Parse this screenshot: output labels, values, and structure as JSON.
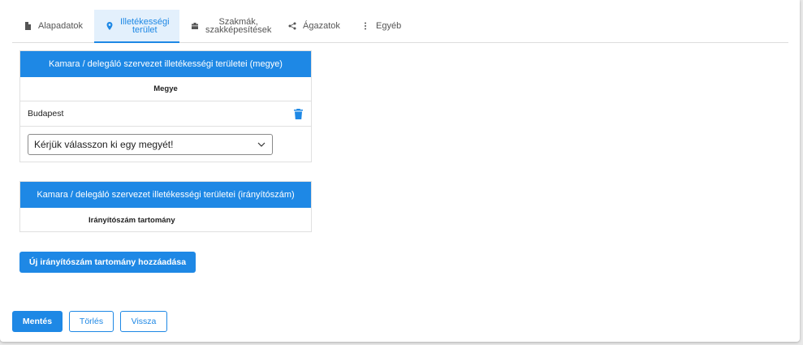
{
  "tabs": [
    {
      "label": "Alapadatok",
      "icon": "document-icon"
    },
    {
      "label": "Illetékességi terület",
      "icon": "location-pin-icon",
      "active": true
    },
    {
      "label": "Szakmák, szakképesítések",
      "icon": "briefcase-icon"
    },
    {
      "label": "Ágazatok",
      "icon": "share-icon"
    },
    {
      "label": "Egyéb",
      "icon": "more-vertical-icon"
    }
  ],
  "county_table": {
    "title": "Kamara / delegáló szervezet illetékességi területei (megye)",
    "column_header": "Megye",
    "rows": [
      {
        "name": "Budapest"
      }
    ],
    "select_placeholder": "Kérjük válasszon ki egy megyét!"
  },
  "zip_table": {
    "title": "Kamara / delegáló szervezet illetékességi területei (irányítószám)",
    "column_header": "Irányítószám tartomány"
  },
  "buttons": {
    "add_range": "Új irányítószám tartomány hozzáadása",
    "save": "Mentés",
    "delete": "Törlés",
    "back": "Vissza"
  },
  "colors": {
    "accent": "#1e88e5",
    "active_tab_bg": "#e3f0fc"
  }
}
